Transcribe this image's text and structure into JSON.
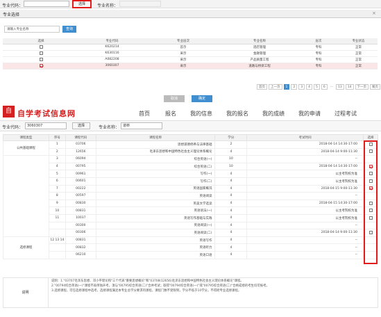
{
  "top_search": {
    "code_label": "专业代码：",
    "code_value": "",
    "select_label": "选择",
    "name_label": "专业名称："
  },
  "modal": {
    "title": "专业选择",
    "close_icon": "close-icon",
    "search_placeholder": "请输入专业名称",
    "search_label": "查询",
    "columns": [
      "选择",
      "专业代码",
      "专业层次",
      "专业名称",
      "层次",
      "专业状态"
    ],
    "rows": [
      {
        "code": "K620214",
        "level": "首示",
        "name": "酒店管理",
        "tier": "专科",
        "status": "正常",
        "checked": false,
        "highlight": false
      },
      {
        "code": "K630116",
        "level": "采示",
        "name": "金融管理",
        "tier": "专科",
        "status": "正常",
        "checked": false,
        "highlight": false
      },
      {
        "code": "A082208",
        "level": "采示",
        "name": "产品质量工程",
        "tier": "专科",
        "status": "正常",
        "checked": false,
        "highlight": false
      },
      {
        "code": "3060307",
        "level": "采示",
        "name": "道路与桥梁工程",
        "tier": "专科",
        "status": "正常",
        "checked": true,
        "highlight": true
      }
    ],
    "pager": [
      "首页",
      "上一页",
      "1",
      "2",
      "3",
      "4",
      "5",
      "6",
      "...",
      "13",
      "14",
      "下一页",
      "尾页"
    ],
    "pager_current": "1",
    "cancel_label": "取消",
    "ok_label": "确定"
  },
  "site": {
    "logo_mark": "自",
    "logo_text": "自学考试信息网",
    "nav": [
      "首页",
      "报名",
      "我的信息",
      "我的报名",
      "我的成绩",
      "我的申请",
      "过程考试"
    ]
  },
  "filter": {
    "code_label": "专业代码：",
    "code_value": "3060307",
    "select_label": "选择",
    "name_label": "专业名称：",
    "name_value": "道桥"
  },
  "course_table": {
    "columns": [
      "课程类型",
      "序号",
      "课程代码",
      "课程名称",
      "学分",
      "考试时间",
      "选择"
    ],
    "rows": [
      {
        "group": "公共基础课程",
        "seq": "1",
        "code": "03706",
        "name": "思想道德修养与法律基础",
        "credit": "2",
        "time": "2018-04-14 14:30-17:00",
        "check": "box"
      },
      {
        "group": "",
        "seq": "2",
        "code": "12656",
        "name": "毛泽东思想和中国特色社会主义理论体系概论",
        "credit": "4",
        "time": "2018-04-14 9:00-11:30",
        "check": "box"
      },
      {
        "group": "",
        "seq": "3",
        "code": "06094",
        "name": "综合英语(一)",
        "credit": "10",
        "time": "--",
        "check": "none"
      },
      {
        "group": "",
        "seq": "4",
        "code": "00795",
        "name": "综合英语(二)",
        "credit": "10",
        "time": "2018-04-14 14:30-17:00",
        "check": "on"
      },
      {
        "group": "",
        "seq": "5",
        "code": "00961",
        "name": "写作(一)",
        "credit": "4",
        "time": "以主考院校为准",
        "check": "box"
      },
      {
        "group": "",
        "seq": "6",
        "code": "00601",
        "name": "写作(二)",
        "credit": "4",
        "time": "以主考院校为准",
        "check": "box"
      },
      {
        "group": "专业课程",
        "seq": "7",
        "code": "00222",
        "name": "英语国家概况",
        "credit": "4",
        "time": "2018-04-15 9:00-11:30",
        "check": "on"
      },
      {
        "group": "",
        "seq": "8",
        "code": "00597",
        "name": "英语阅读",
        "credit": "4",
        "time": "--",
        "check": "none"
      },
      {
        "group": "",
        "seq": "9",
        "code": "00830",
        "name": "英美文学选读",
        "credit": "4",
        "time": "2018-04-15 14:30-17:00",
        "check": "box"
      },
      {
        "group": "",
        "seq": "10",
        "code": "00831",
        "name": "英语语法(一)",
        "credit": "4",
        "time": "以主考院校为准",
        "check": "box"
      },
      {
        "group": "",
        "seq": "11",
        "code": "10037",
        "name": "英语写作基础与实践",
        "credit": "4",
        "time": "以主考院校为准",
        "check": "box"
      },
      {
        "group": "",
        "seq": "",
        "code": "00300",
        "name": "英语阅读(一)",
        "credit": "4",
        "time": "--",
        "check": "none"
      },
      {
        "group": "",
        "seq": "",
        "code": "00306",
        "name": "英语阅读(二)",
        "credit": "4",
        "time": "2018-04-14 9:00-11:30",
        "check": "box"
      },
      {
        "group": "选修课程",
        "seq": "12 13 14",
        "code": "00831",
        "name": "英语写作",
        "credit": "4",
        "time": "--",
        "check": "none"
      },
      {
        "group": "",
        "seq": "",
        "code": "00832",
        "name": "英语听力",
        "credit": "4",
        "time": "--",
        "check": "none"
      },
      {
        "group": "",
        "seq": "",
        "code": "06210",
        "name": "英语口语",
        "credit": "4",
        "time": "--",
        "check": "none"
      }
    ]
  },
  "note": {
    "label": "说明",
    "lines": [
      "说明：1.\"03707毛泽东思想、邓小平理论和\"三个代表\"重要思想概论\"和\"03708(12656)毛泽东思想和中国特色社会主义理论体系概论\"课程。",
      "2.\"00794综合英语(一)\"课程不再单独开考，须与\"00795综合英语(二)\"合并考试；取得\"00794综合英语(一)\"或\"00795综合英语(二)\"合格成绩的考生均可报考。",
      "3.选修课程，可任选修课程中选考，选修课程满足本专业总学分要求的课程，课程门数不受限制，学分不低于10学分。不得跨专业选修课程。"
    ]
  },
  "colors": {
    "accent": "#3e8ed0",
    "brand": "#d42020",
    "highlight": "#e21b1b"
  }
}
